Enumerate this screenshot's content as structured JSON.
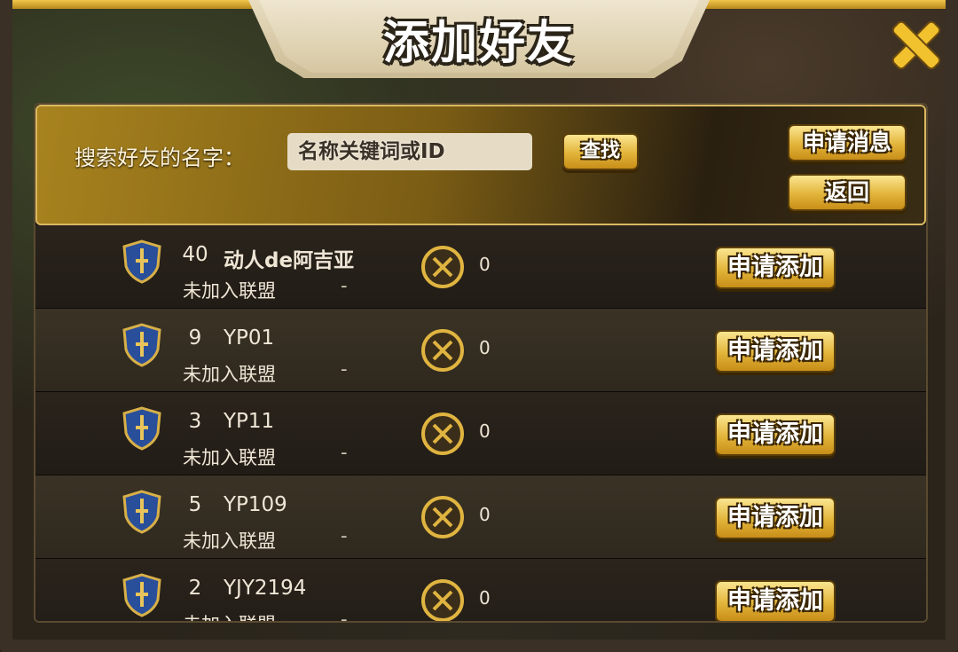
{
  "header": {
    "title": "添加好友"
  },
  "search": {
    "label": "搜索好友的名字：",
    "placeholder": "名称关键词或ID",
    "find_label": "查找",
    "request_msg_label": "申请消息",
    "back_label": "返回"
  },
  "players": [
    {
      "level": "40",
      "name": "动人de阿吉亚",
      "alliance": "未加入联盟",
      "alliance_rank": "-",
      "power": "0",
      "action": "申请添加"
    },
    {
      "level": "9",
      "name": "YP01",
      "alliance": "未加入联盟",
      "alliance_rank": "-",
      "power": "0",
      "action": "申请添加"
    },
    {
      "level": "3",
      "name": "YP11",
      "alliance": "未加入联盟",
      "alliance_rank": "-",
      "power": "0",
      "action": "申请添加"
    },
    {
      "level": "5",
      "name": "YP109",
      "alliance": "未加入联盟",
      "alliance_rank": "-",
      "power": "0",
      "action": "申请添加"
    },
    {
      "level": "2",
      "name": "YJY2194",
      "alliance": "未加入联盟",
      "alliance_rank": "-",
      "power": "0",
      "action": "申请添加"
    }
  ],
  "colors": {
    "gold": "#e2b43a",
    "panel_dark": "#171310",
    "title_plate": "#efe6cf"
  }
}
